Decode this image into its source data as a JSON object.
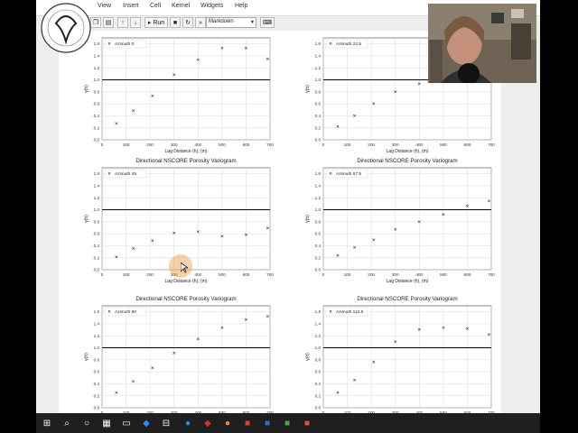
{
  "menu": {
    "items": [
      "View",
      "Insert",
      "Cell",
      "Kernel",
      "Widgets",
      "Help"
    ]
  },
  "toolbar": {
    "run_label": "Run",
    "cell_type": "Markdown"
  },
  "common": {
    "xlabel": "Lag Distance (h), (m)",
    "ylabel": "γ(h)",
    "xticks": [
      0,
      100,
      200,
      300,
      400,
      500,
      600,
      700
    ],
    "yticks": [
      0.0,
      0.2,
      0.4,
      0.6,
      0.8,
      1.0,
      1.2,
      1.4,
      1.6
    ]
  },
  "chart_data": [
    {
      "type": "scatter",
      "title": "",
      "legend": "Azimuth 0",
      "xlim": [
        0,
        700
      ],
      "ylim": [
        0,
        1.7
      ],
      "x": [
        60,
        130,
        210,
        300,
        400,
        500,
        600,
        690
      ],
      "y": [
        0.27,
        0.48,
        0.73,
        1.08,
        1.33,
        1.53,
        1.53,
        1.35
      ]
    },
    {
      "type": "scatter",
      "title": "",
      "legend": "Azimuth 22.5",
      "xlim": [
        0,
        700
      ],
      "ylim": [
        0,
        1.7
      ],
      "x": [
        60,
        130,
        210,
        300,
        400
      ],
      "y": [
        0.22,
        0.4,
        0.6,
        0.8,
        0.93
      ]
    },
    {
      "type": "scatter",
      "title": "Directional NSCORE Porosity Variogram",
      "legend": "Azimuth 45",
      "xlim": [
        0,
        700
      ],
      "ylim": [
        0,
        1.7
      ],
      "x": [
        60,
        130,
        210,
        300,
        400,
        500,
        600,
        690
      ],
      "y": [
        0.21,
        0.35,
        0.48,
        0.61,
        0.63,
        0.56,
        0.58,
        0.69
      ]
    },
    {
      "type": "scatter",
      "title": "Directional NSCORE Porosity Variogram",
      "legend": "Azimuth 67.5",
      "xlim": [
        0,
        700
      ],
      "ylim": [
        0,
        1.7
      ],
      "x": [
        60,
        130,
        210,
        300,
        400,
        500,
        600,
        690
      ],
      "y": [
        0.23,
        0.37,
        0.5,
        0.67,
        0.8,
        0.92,
        1.06,
        1.14
      ]
    },
    {
      "type": "scatter",
      "title": "Directional NSCORE Porosity Variogram",
      "legend": "Azimuth 90",
      "xlim": [
        0,
        700
      ],
      "ylim": [
        0,
        1.7
      ],
      "x": [
        60,
        130,
        210,
        300,
        400,
        500,
        600,
        690
      ],
      "y": [
        0.25,
        0.44,
        0.66,
        0.91,
        1.14,
        1.33,
        1.47,
        1.52
      ]
    },
    {
      "type": "scatter",
      "title": "Directional NSCORE Porosity Variogram",
      "legend": "Azimuth 112.5",
      "xlim": [
        0,
        700
      ],
      "ylim": [
        0,
        1.7
      ],
      "x": [
        60,
        130,
        210,
        300,
        400,
        500,
        600,
        690
      ],
      "y": [
        0.25,
        0.46,
        0.76,
        1.1,
        1.3,
        1.33,
        1.32,
        1.22
      ]
    }
  ],
  "colors": {
    "sill": "#000000",
    "grid": "#d9d9d9",
    "marker": "#000000",
    "highlight": "#f0963c"
  }
}
